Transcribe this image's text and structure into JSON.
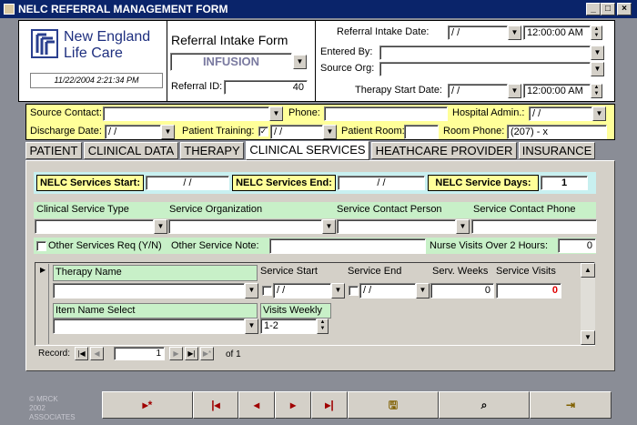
{
  "window": {
    "title": "NELC REFERRAL MANAGEMENT FORM",
    "min": "_",
    "max": "□",
    "close": "×"
  },
  "logo": {
    "line1": "New England",
    "line2": "Life Care"
  },
  "header": {
    "timestamp": "11/22/2004 2:21:34 PM",
    "form_title": "Referral Intake Form",
    "category": "INFUSION",
    "referral_id_label": "Referral ID:",
    "referral_id": "40",
    "intake_date_label": "Referral Intake Date:",
    "intake_date": "/  /",
    "intake_time": "12:00:00 AM",
    "entered_by_label": "Entered By:",
    "entered_by": "",
    "source_org_label": "Source Org:",
    "source_org": "",
    "therapy_start_label": "Therapy Start Date:",
    "therapy_start_date": "/  /",
    "therapy_start_time": "12:00:00 AM"
  },
  "contact": {
    "source_contact_label": "Source Contact:",
    "phone_label": "Phone:",
    "hospital_admin_label": "Hospital Admin.:",
    "hospital_admin": "/  /",
    "discharge_label": "Discharge Date:",
    "discharge_date": "/  /",
    "patient_training_label": "Patient Training:",
    "patient_training_date": "/  /",
    "patient_room_label": "Patient Room:",
    "room_phone_label": "Room Phone:",
    "room_phone": "(207)    -      x"
  },
  "tabs": [
    "PATIENT",
    "CLINICAL DATA",
    "THERAPY",
    "CLINICAL SERVICES",
    "HEATHCARE PROVIDER",
    "INSURANCE"
  ],
  "services": {
    "start_label": "NELC Services Start:",
    "start_value": "/  /",
    "end_label": "NELC Services End:",
    "end_value": "/  /",
    "days_label": "NELC Service Days:",
    "days_value": "1",
    "type_label": "Clinical Service Type",
    "org_label": "Service Organization",
    "contact_person_label": "Service Contact Person",
    "contact_phone_label": "Service Contact Phone",
    "other_req_label": "Other Services Req (Y/N)",
    "other_note_label": "Other Service Note:",
    "nurse_visits_label": "Nurse Visits Over 2 Hours:",
    "nurse_visits_value": "0"
  },
  "subform": {
    "therapy_name_label": "Therapy Name",
    "service_start_label": "Service Start",
    "service_start": "/  /",
    "service_end_label": "Service End",
    "service_end": "/  /",
    "serv_weeks_label": "Serv. Weeks",
    "serv_weeks": "0",
    "service_visits_label": "Service Visits",
    "service_visits": "0",
    "item_name_label": "Item Name Select",
    "visits_weekly_label": "Visits Weekly",
    "visits_weekly": "1-2",
    "record_label": "Record:",
    "record_value": "1",
    "of_label": "of 1"
  },
  "footer": {
    "copyright": "© MRCK 2002 ASSOCIATES"
  },
  "colors": {
    "title_bar": "#0a246a",
    "yellow": "#ffff99",
    "green": "#c8f0c8",
    "cyan": "#c8f0f0",
    "visits_red": "#e00000"
  }
}
